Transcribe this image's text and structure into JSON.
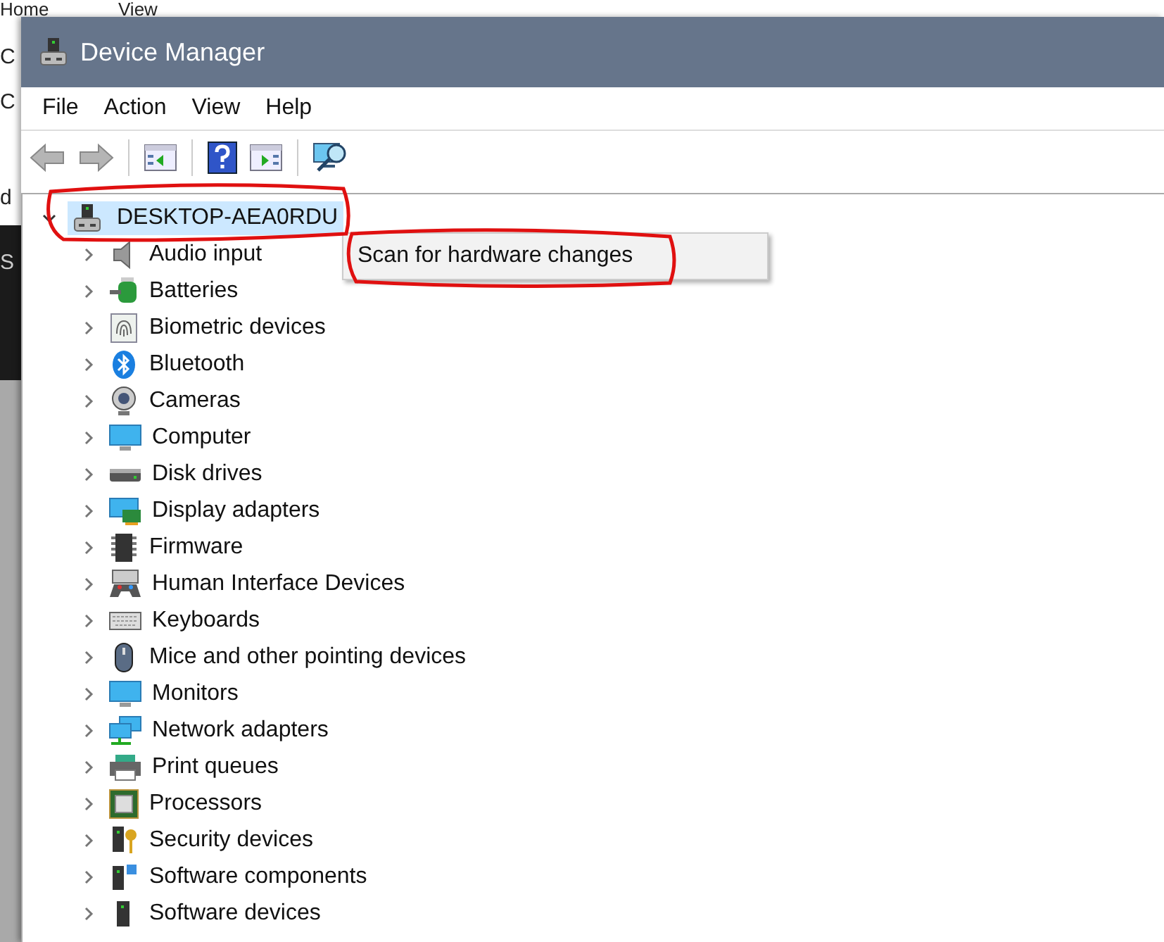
{
  "background_window": {
    "tabs": [
      "Home",
      "View"
    ],
    "side_texts": [
      "C",
      "C",
      "d"
    ],
    "dark_text": "S"
  },
  "window": {
    "title": "Device Manager"
  },
  "menu_bar": [
    "File",
    "Action",
    "View",
    "Help"
  ],
  "toolbar": [
    {
      "kind": "back",
      "disabled": true
    },
    {
      "kind": "forward",
      "disabled": true
    },
    {
      "kind": "tree",
      "disabled": false
    },
    {
      "kind": "help",
      "disabled": false
    },
    {
      "kind": "pane",
      "disabled": false
    },
    {
      "kind": "scan",
      "disabled": false
    }
  ],
  "tree": {
    "label": "DESKTOP-AEA0RDU",
    "selected": true,
    "expanded": true,
    "children": [
      {
        "label": "Audio input",
        "expanded": false
      },
      {
        "label": "Batteries",
        "expanded": false
      },
      {
        "label": "Biometric devices",
        "expanded": false
      },
      {
        "label": "Bluetooth",
        "expanded": false
      },
      {
        "label": "Cameras",
        "expanded": false
      },
      {
        "label": "Computer",
        "expanded": false
      },
      {
        "label": "Disk drives",
        "expanded": false
      },
      {
        "label": "Display adapters",
        "expanded": false
      },
      {
        "label": "Firmware",
        "expanded": false
      },
      {
        "label": "Human Interface Devices",
        "expanded": false
      },
      {
        "label": "Keyboards",
        "expanded": false
      },
      {
        "label": "Mice and other pointing devices",
        "expanded": false
      },
      {
        "label": "Monitors",
        "expanded": false
      },
      {
        "label": "Network adapters",
        "expanded": false
      },
      {
        "label": "Print queues",
        "expanded": false
      },
      {
        "label": "Processors",
        "expanded": false
      },
      {
        "label": "Security devices",
        "expanded": false
      },
      {
        "label": "Software components",
        "expanded": false
      },
      {
        "label": "Software devices",
        "expanded": false
      }
    ]
  },
  "context_menu": {
    "items": [
      "Scan for hardware changes"
    ]
  }
}
